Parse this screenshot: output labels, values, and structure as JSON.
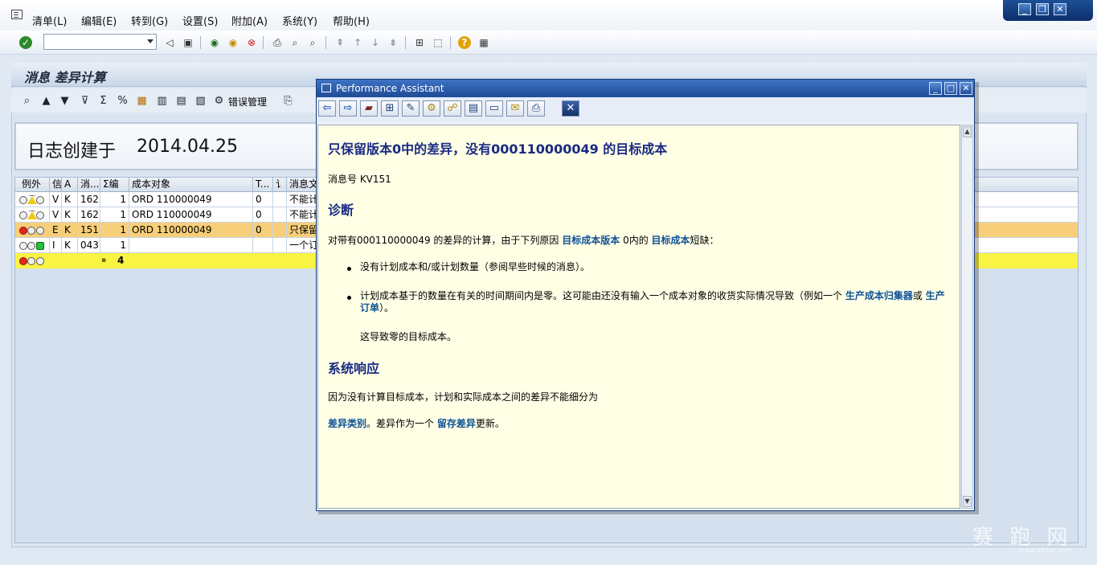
{
  "menu": {
    "items": [
      "清单(L)",
      "编辑(E)",
      "转到(G)",
      "设置(S)",
      "附加(A)",
      "系统(Y)",
      "帮助(H)"
    ]
  },
  "command_field": {
    "value": ""
  },
  "screen": {
    "title": "消息 差异计算",
    "toolbar_text_button": "错误管理"
  },
  "log_header": {
    "label": "日志创建于",
    "date": "2014.04.25"
  },
  "grid": {
    "columns": [
      "例外",
      "信",
      "A",
      "消...",
      "Σ编",
      "成本对象",
      "T...",
      "讠",
      "消息文"
    ],
    "rows": [
      {
        "lights": "yellow-tri",
        "type": "V",
        "area": "K",
        "msg": "162",
        "count": "1",
        "object": "ORD 110000049",
        "t": "0",
        "text": "不能计"
      },
      {
        "lights": "yellow-tri",
        "type": "V",
        "area": "K",
        "msg": "162",
        "count": "1",
        "object": "ORD 110000049",
        "t": "0",
        "text": "不能计"
      },
      {
        "lights": "red",
        "type": "E",
        "area": "K",
        "msg": "151",
        "count": "1",
        "object": "ORD 110000049",
        "t": "0",
        "text": "只保留"
      },
      {
        "lights": "green",
        "type": "I",
        "area": "K",
        "msg": "043",
        "count": "1",
        "object": "",
        "t": "",
        "text": "一个订"
      }
    ],
    "total": {
      "marker": "▪",
      "count": "4"
    }
  },
  "assistant": {
    "title": "Performance Assistant",
    "heading": "只保留版本0中的差异，没有000110000049  的目标成本",
    "message_no": "消息号  KV151",
    "diagnosis": {
      "title": "诊断",
      "intro_pre": "对带有000110000049 的差异的计算，由于下列原因 ",
      "intro_link1": "目标成本版本",
      "intro_mid": " 0内的 ",
      "intro_link2": "目标成本",
      "intro_post": "短缺：",
      "bullet1": "没有计划成本和/或计划数量（参阅早些时候的消息）。",
      "bullet2_pre": "计划成本基于的数量在有关的时间期间内是零。这可能由还没有输入一个成本对象的收货实际情况导致（例如一个 ",
      "bullet2_link1": "生产成本归集器",
      "bullet2_mid": "或 ",
      "bullet2_link2": "生产订单",
      "bullet2_post": "）。",
      "note": "这导致零的目标成本。"
    },
    "system_response": {
      "title": "系统响应",
      "text": "因为没有计算目标成本，计划和实际成本之间的差异不能细分为",
      "link1": "差异类别",
      "mid": "。差异作为一个 ",
      "link2": "留存差异",
      "post": "更新。"
    }
  },
  "watermark": {
    "text": "赛 跑 网",
    "sub": "www.315sp.com"
  }
}
